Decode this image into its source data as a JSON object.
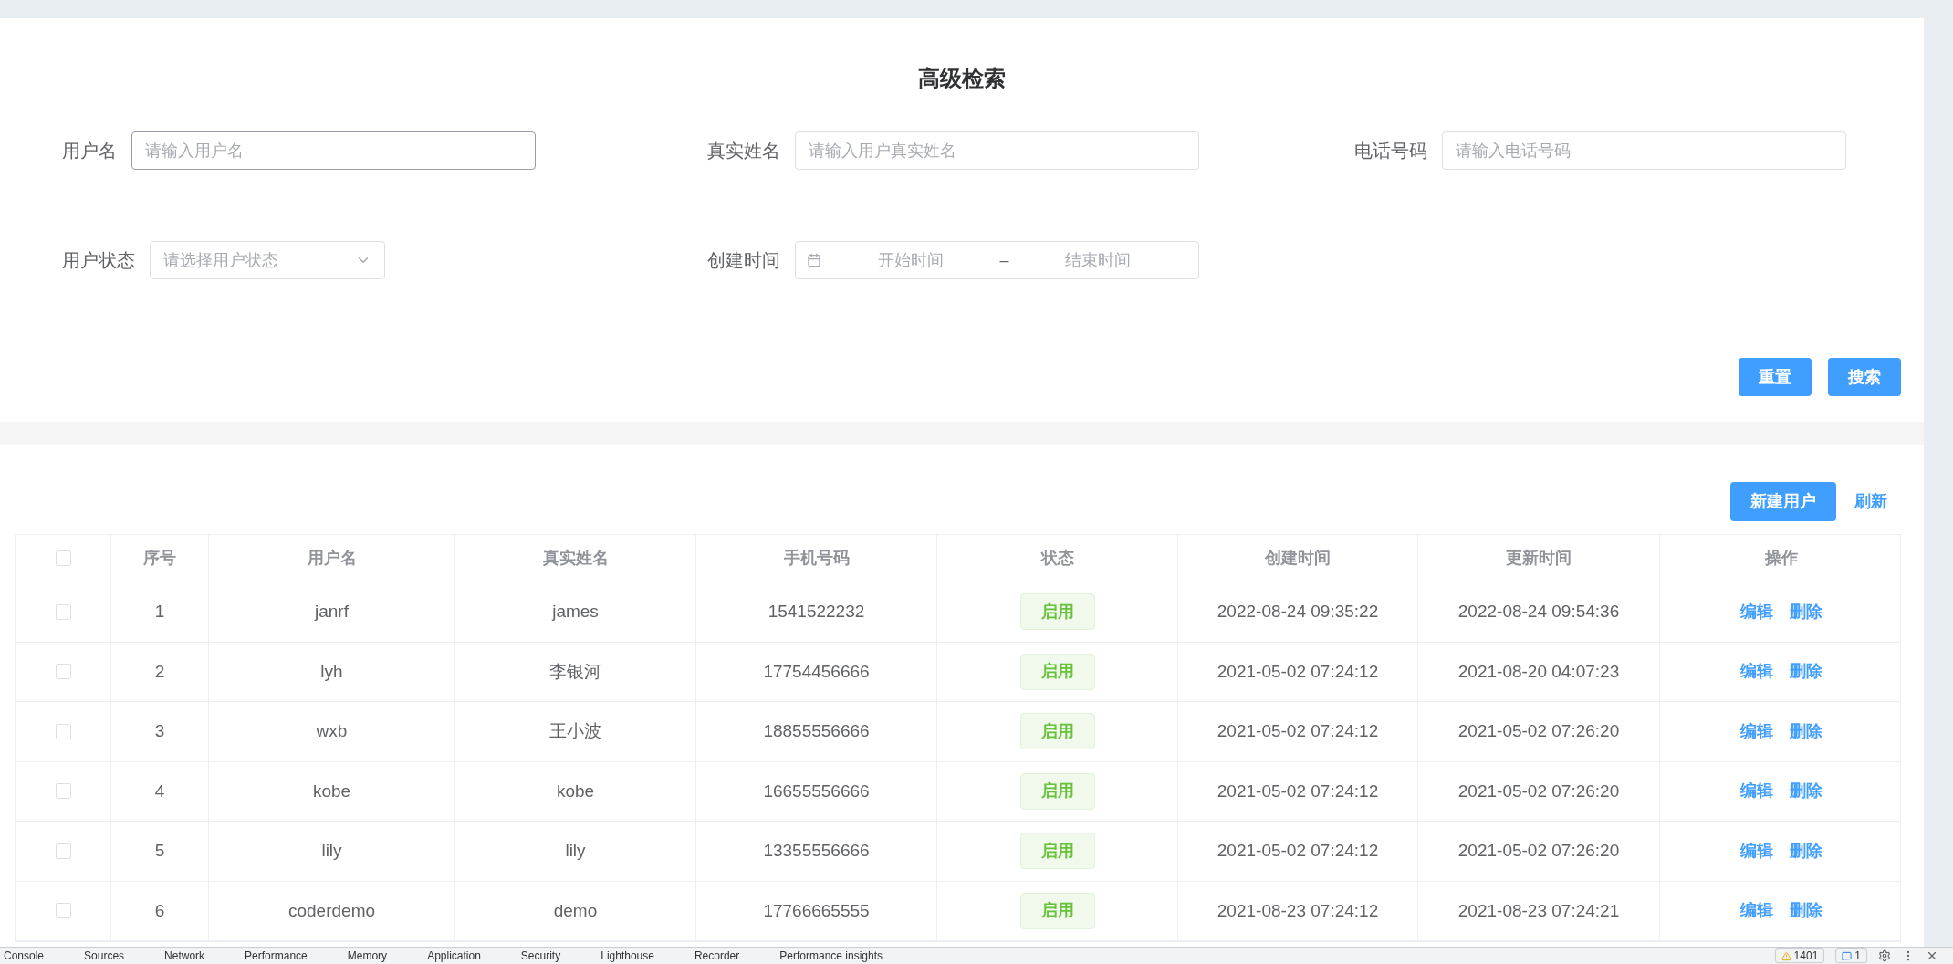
{
  "search": {
    "title": "高级检索",
    "fields": [
      {
        "label": "用户名",
        "placeholder": "请输入用户名",
        "kind": "text",
        "focused": true
      },
      {
        "label": "真实姓名",
        "placeholder": "请输入用户真实姓名",
        "kind": "text",
        "focused": false
      },
      {
        "label": "电话号码",
        "placeholder": "请输入电话号码",
        "kind": "text",
        "focused": false
      },
      {
        "label": "用户状态",
        "placeholder": "请选择用户状态",
        "kind": "select",
        "focused": false
      },
      {
        "label": "创建时间",
        "start_placeholder": "开始时间",
        "separator": "–",
        "end_placeholder": "结束时间",
        "kind": "daterange",
        "focused": false
      }
    ],
    "buttons": [
      "重置",
      "搜索"
    ]
  },
  "table": {
    "create_button": "新建用户",
    "refresh_link": "刷新",
    "header_checked": false,
    "columns": [
      "序号",
      "用户名",
      "真实姓名",
      "手机号码",
      "状态",
      "创建时间",
      "更新时间",
      "操作"
    ],
    "rows": [
      {
        "checked": false,
        "index": "1",
        "username": "janrf",
        "real_name": "james",
        "phone": "1541522232",
        "status": "启用",
        "enabled": true,
        "created": "2022-08-24 09:35:22",
        "updated": "2022-08-24 09:54:36",
        "actions": [
          "编辑",
          "删除"
        ]
      },
      {
        "checked": false,
        "index": "2",
        "username": "lyh",
        "real_name": "李银河",
        "phone": "17754456666",
        "status": "启用",
        "enabled": true,
        "created": "2021-05-02 07:24:12",
        "updated": "2021-08-20 04:07:23",
        "actions": [
          "编辑",
          "删除"
        ]
      },
      {
        "checked": false,
        "index": "3",
        "username": "wxb",
        "real_name": "王小波",
        "phone": "18855556666",
        "status": "启用",
        "enabled": true,
        "created": "2021-05-02 07:24:12",
        "updated": "2021-05-02 07:26:20",
        "actions": [
          "编辑",
          "删除"
        ]
      },
      {
        "checked": false,
        "index": "4",
        "username": "kobe",
        "real_name": "kobe",
        "phone": "16655556666",
        "status": "启用",
        "enabled": true,
        "created": "2021-05-02 07:24:12",
        "updated": "2021-05-02 07:26:20",
        "actions": [
          "编辑",
          "删除"
        ]
      },
      {
        "checked": false,
        "index": "5",
        "username": "lily",
        "real_name": "lily",
        "phone": "13355556666",
        "status": "启用",
        "enabled": true,
        "created": "2021-05-02 07:24:12",
        "updated": "2021-05-02 07:26:20",
        "actions": [
          "编辑",
          "删除"
        ]
      },
      {
        "checked": false,
        "index": "6",
        "username": "coderdemo",
        "real_name": "demo",
        "phone": "17766665555",
        "status": "启用",
        "enabled": true,
        "created": "2021-08-23 07:24:12",
        "updated": "2021-08-23 07:24:21",
        "actions": [
          "编辑",
          "删除"
        ]
      }
    ]
  },
  "devtools": {
    "tabs": [
      "Console",
      "Sources",
      "Network",
      "Performance",
      "Memory",
      "Application",
      "Security",
      "Lighthouse",
      "Recorder",
      "Performance insights"
    ],
    "warnings": "1401",
    "messages": "1"
  }
}
